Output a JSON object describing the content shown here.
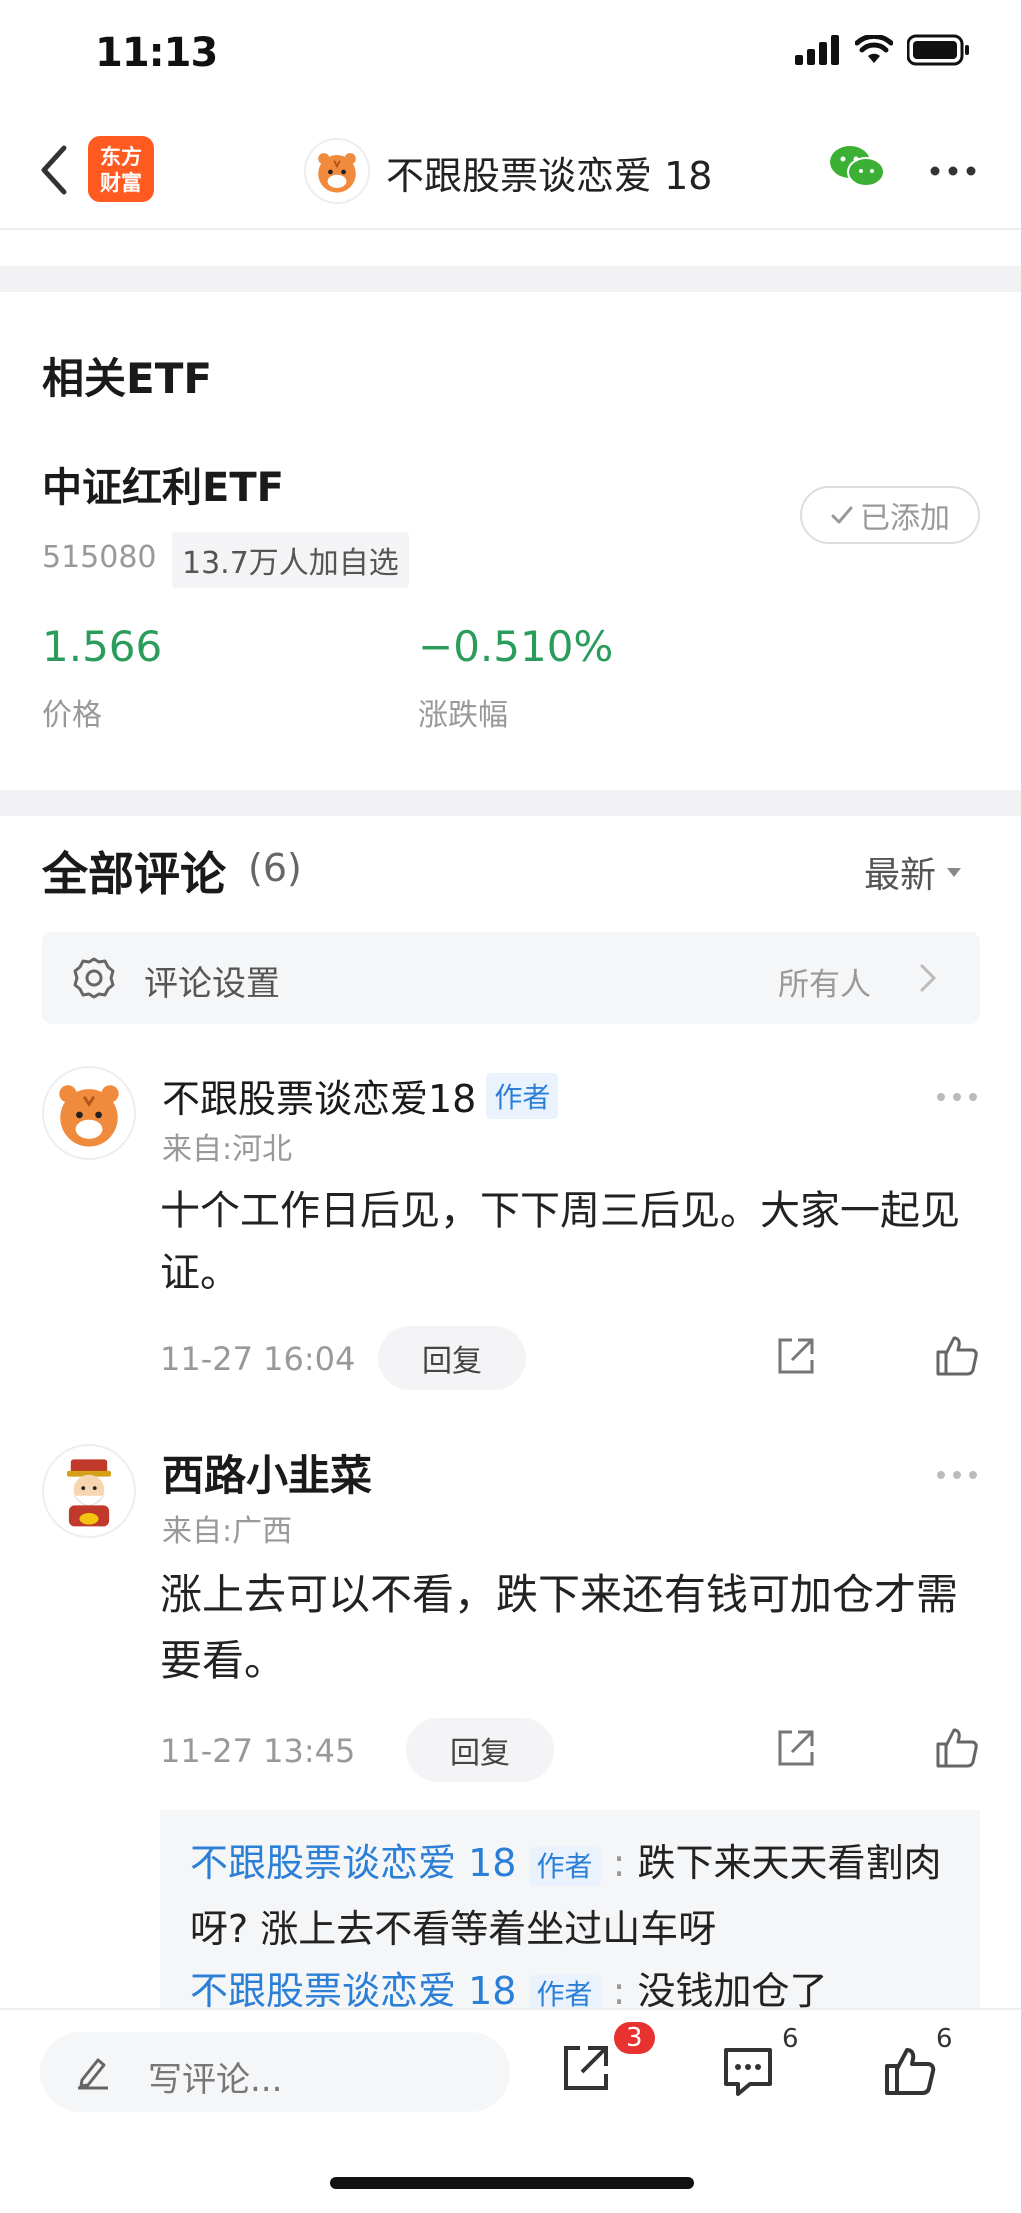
{
  "status_bar": {
    "time": "11:13"
  },
  "navbar": {
    "app_logo_line1": "东方",
    "app_logo_line2": "财富",
    "title": "不跟股票谈恋爱 18"
  },
  "related_etf": {
    "heading": "相关ETF",
    "name": "中证红利ETF",
    "code": "515080",
    "followers": "13.7万人加自选",
    "added_label": "已添加",
    "price": "1.566",
    "price_label": "价格",
    "change": "−0.510%",
    "change_label": "涨跌幅",
    "change_color": "#2a9d5c"
  },
  "comments": {
    "title": "全部评论",
    "count": "(6)",
    "sort_label": "最新",
    "settings_label": "评论设置",
    "settings_value": "所有人",
    "items": [
      {
        "user": "不跟股票谈恋爱18",
        "tag": "作者",
        "location": "来自:河北",
        "text": "十个工作日后见，下下周三后见。大家一起见证。",
        "time": "11-27 16:04",
        "reply_label": "回复"
      },
      {
        "user": "西路小韭菜",
        "location": "来自:广西",
        "text": "涨上去可以不看，跌下来还有钱可加仓才需要看。",
        "time": "11-27 13:45",
        "reply_label": "回复",
        "replies": [
          {
            "user": "不跟股票谈恋爱 18",
            "tag": "作者",
            "text": "跌下来天天看割肉呀? 涨上去不看等着坐过山车呀"
          },
          {
            "user": "不跟股票谈恋爱 18",
            "tag": "作者",
            "text": "没钱加仓了"
          }
        ]
      }
    ]
  },
  "bottom_bar": {
    "write_placeholder": "写评论...",
    "share_badge": "3",
    "comment_count": "6",
    "like_count": "6"
  }
}
